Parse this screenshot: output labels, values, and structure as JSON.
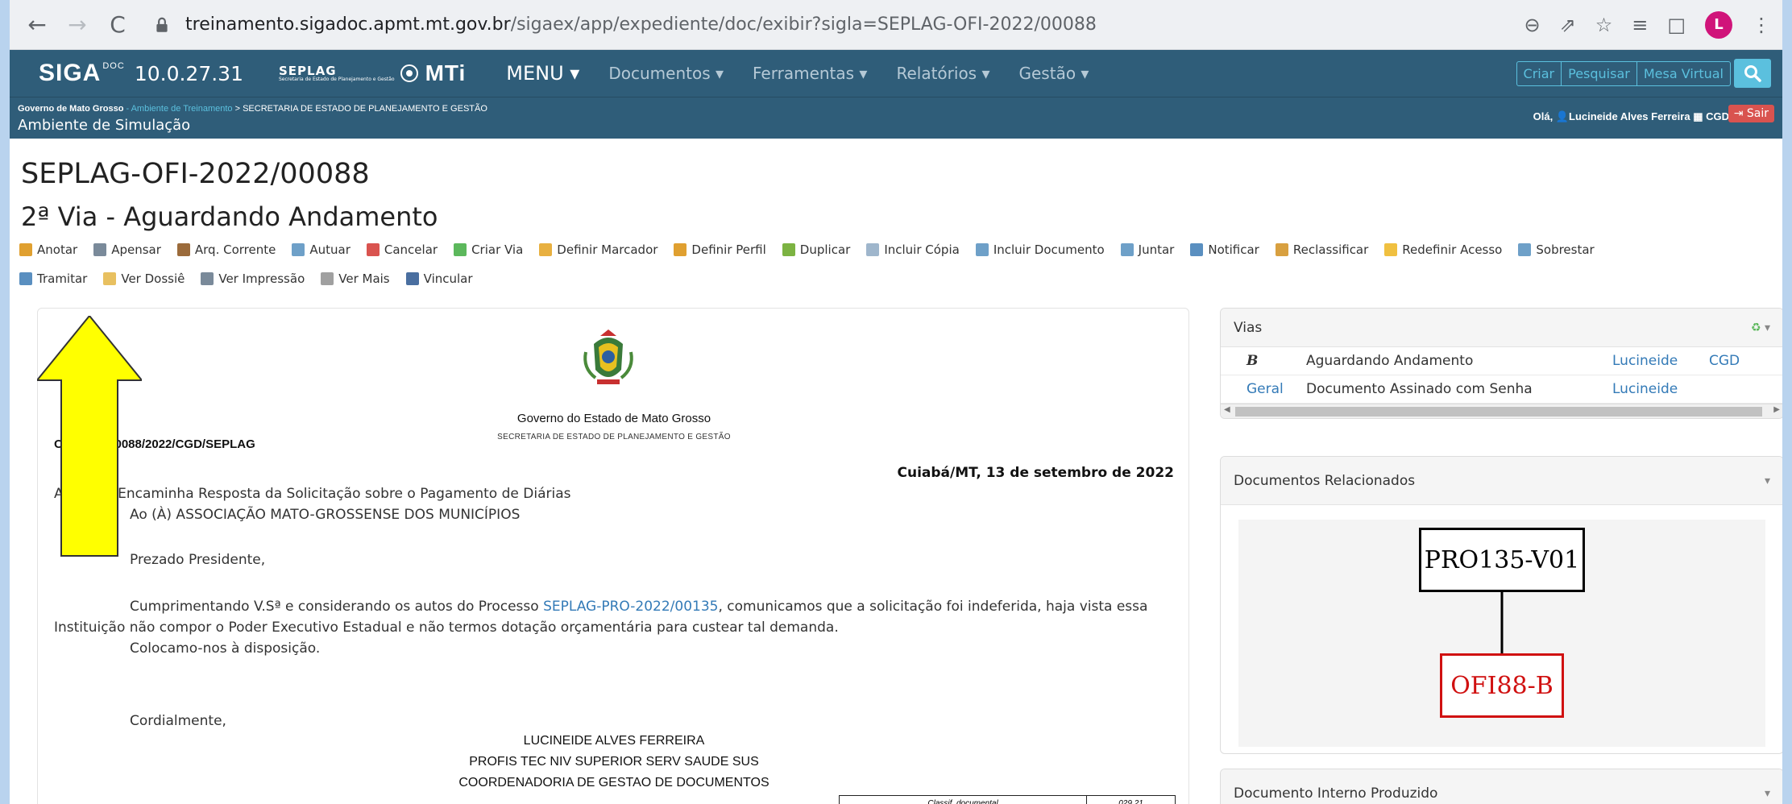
{
  "browser": {
    "url_host": "treinamento.sigadoc.apmt.mt.gov.br",
    "url_path": "/sigaex/app/expediente/doc/exibir?sigla=SEPLAG-OFI-2022/00088",
    "profile_initial": "L"
  },
  "navbar": {
    "logo": "SIGA",
    "logo_sup": "DOC",
    "version": "10.0.27.31",
    "seplag": "SEPLAG",
    "seplag_sub": "Secretaria de Estado de Planejamento e Gestão",
    "mti": "MTi",
    "menu": "MENU ▾",
    "items": [
      "Documentos ▾",
      "Ferramentas ▾",
      "Relatórios ▾",
      "Gestão ▾"
    ],
    "right_buttons": [
      "Criar",
      "Pesquisar",
      "Mesa Virtual"
    ]
  },
  "subbar": {
    "gov": "Governo de Mato Grosso",
    "env": " - Ambiente de Treinamento",
    "secretaria": " > SECRETARIA DE ESTADO DE PLANEJAMENTO E GESTÃO",
    "ambiente": "Ambiente de Simulação",
    "greeting_prefix": "Olá, ",
    "user": "Lucineide Alves Ferreira",
    "unit": "CGD",
    "logout": "Sair"
  },
  "document": {
    "title": "SEPLAG-OFI-2022/00088",
    "subtitle": "2ª Via - Aguardando Andamento"
  },
  "toolbar": {
    "row1": [
      {
        "label": "Anotar",
        "color": "#e0a030"
      },
      {
        "label": "Apensar",
        "color": "#7a8a9a"
      },
      {
        "label": "Arq. Corrente",
        "color": "#9b6b3b"
      },
      {
        "label": "Autuar",
        "color": "#6ea0c8"
      },
      {
        "label": "Cancelar",
        "color": "#d9534f"
      },
      {
        "label": "Criar Via",
        "color": "#5cb85c"
      },
      {
        "label": "Definir Marcador",
        "color": "#e8b040"
      },
      {
        "label": "Definir Perfil",
        "color": "#e0a030"
      },
      {
        "label": "Duplicar",
        "color": "#7cb342"
      },
      {
        "label": "Incluir Cópia",
        "color": "#9fb6cc"
      },
      {
        "label": "Incluir Documento",
        "color": "#6ea0c8"
      },
      {
        "label": "Juntar",
        "color": "#6ea0c8"
      },
      {
        "label": "Notificar",
        "color": "#5a8fc0"
      },
      {
        "label": "Reclassificar",
        "color": "#d8a040"
      },
      {
        "label": "Redefinir Acesso",
        "color": "#f0c040"
      },
      {
        "label": "Sobrestar",
        "color": "#6ea0c8"
      }
    ],
    "row2": [
      {
        "label": "Tramitar",
        "color": "#5a8fc0"
      },
      {
        "label": "Ver Dossiê",
        "color": "#e8c060"
      },
      {
        "label": "Ver Impressão",
        "color": "#7a8a9a"
      },
      {
        "label": "Ver Mais",
        "color": "#a0a0a0"
      },
      {
        "label": "Vincular",
        "color": "#4a6fa0"
      }
    ]
  },
  "letter": {
    "gov_title": "Governo do Estado de Mato Grosso",
    "gov_sub": "SECRETARIA DE ESTADO DE PLANEJAMENTO E GESTÃO",
    "oficio_no": "Ofício Nº 00088/2022/CGD/SEPLAG",
    "date": "Cuiabá/MT, 13 de setembro de 2022",
    "assunto": "Assunto: Encaminha Resposta da Solicitação sobre o Pagamento de Diárias",
    "destinatario": "Ao (À) ASSOCIAÇÃO MATO-GROSSENSE DOS MUNICÍPIOS",
    "saudacao": "Prezado Presidente,",
    "body_start": "Cumprimentando V.Sª e considerando os autos do Processo ",
    "body_link": "SEPLAG-PRO-2022/00135",
    "body_end": ", comunicamos que a solicitação foi indeferida, haja vista essa",
    "body_line2": "Instituição não compor o Poder Executivo Estadual e não termos dotação orçamentária para custear tal demanda.",
    "body_line3": "Colocamo-nos à disposição.",
    "closing": "Cordialmente,",
    "signer_name": "LUCINEIDE ALVES FERREIRA",
    "signer_role": "PROFIS TEC NIV SUPERIOR SERV SAUDE SUS",
    "signer_unit": "COORDENADORIA DE GESTAO DE DOCUMENTOS",
    "class_label": "Classif. documental",
    "class_value": "029.21"
  },
  "vias": {
    "title": "Vias",
    "rows": [
      {
        "via": "B",
        "status": "Aguardando Andamento",
        "user": "Lucineide",
        "unit": "CGD"
      },
      {
        "via": "Geral",
        "status": "Documento Assinado com Senha",
        "user": "Lucineide",
        "unit": ""
      }
    ]
  },
  "related": {
    "title": "Documentos Relacionados",
    "node_parent": "PRO135-V01",
    "node_child": "OFI88-B"
  },
  "internal": {
    "title": "Documento Interno Produzido"
  }
}
